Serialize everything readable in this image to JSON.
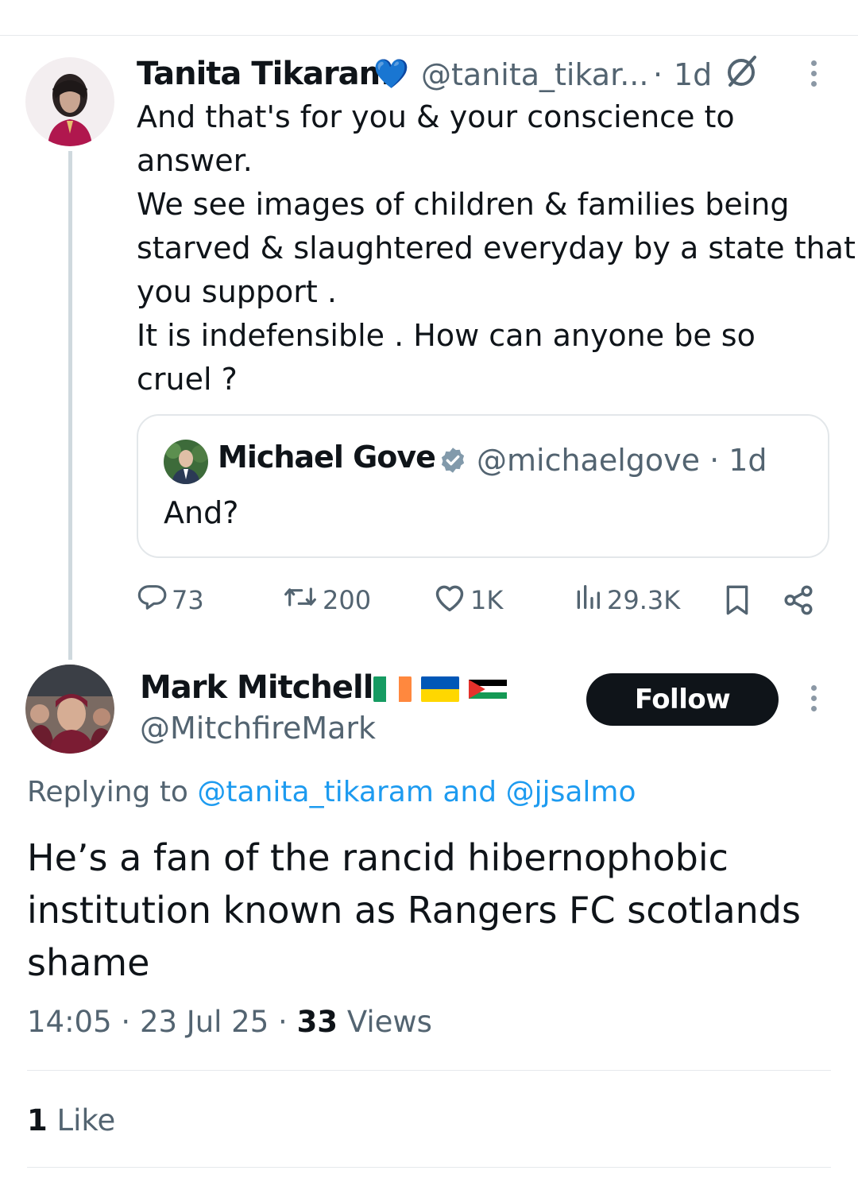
{
  "parent_tweet": {
    "author_name": "Tanita Tikaram",
    "author_emoji": "💙",
    "handle": "@tanita_tikar...",
    "separator": "·",
    "time": "1d",
    "lines": [
      "And that's for you & your conscience to",
      "answer.",
      "We see images of children & families being",
      "starved & slaughtered everyday by a state that",
      "you support .",
      "It is indefensible . How can anyone be so",
      "cruel ?"
    ],
    "quote": {
      "author_name": "Michael Gove",
      "handle": "@michaelgove · 1d",
      "text": "And?"
    },
    "stats": {
      "replies": "73",
      "reposts": "200",
      "likes": "1K",
      "views": "29.3K"
    }
  },
  "reply": {
    "author_name": "Mark Mitchell.",
    "handle": "@MitchfireMark",
    "follow_label": "Follow",
    "replying_prefix": "Replying to",
    "replying_user1": "@tanita_tikaram",
    "replying_and": "and",
    "replying_user2": "@jjsalmo",
    "lines": [
      "He’s a fan of the rancid hibernophobic",
      "institution known as Rangers FC scotlands",
      "shame"
    ],
    "time": "14:05",
    "date": "23 Jul 25",
    "views_count": "33",
    "views_label": "Views",
    "likes_count": "1",
    "likes_label": "Like"
  },
  "icons": {
    "grok": "slashed-circle-icon",
    "more": "more-vertical-icon",
    "verified": "verified-badge-icon",
    "reply": "reply-icon",
    "repost": "repost-icon",
    "like": "heart-icon",
    "views": "views-icon",
    "bookmark": "bookmark-icon",
    "share": "share-icon"
  },
  "colors": {
    "accent": "#1d9bf0",
    "text": "#0f1419",
    "muted": "#536471",
    "border": "#e6e9ec",
    "verified_grey": "#829aab"
  }
}
